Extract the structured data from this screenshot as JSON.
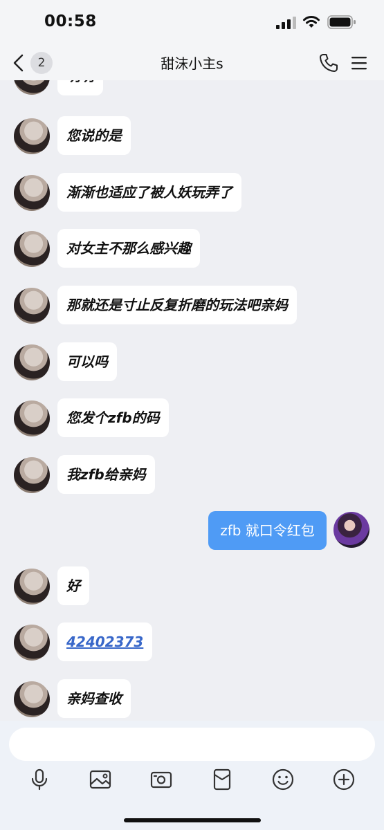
{
  "status_bar": {
    "time": "00:58"
  },
  "nav": {
    "unread_count": "2",
    "title": "甜沫小主s"
  },
  "messages": [
    {
      "side": "left",
      "text": "明明"
    },
    {
      "side": "left",
      "text": "您说的是"
    },
    {
      "side": "left",
      "text": "渐渐也适应了被人妖玩弄了"
    },
    {
      "side": "left",
      "text": "对女主不那么感兴趣"
    },
    {
      "side": "left",
      "text": "那就还是寸止反复折磨的玩法吧亲妈"
    },
    {
      "side": "left",
      "text": "可以吗"
    },
    {
      "side": "left",
      "text": "您发个zfb的码"
    },
    {
      "side": "left",
      "text": "我zfb给亲妈"
    },
    {
      "side": "right",
      "text": "zfb 就口令红包"
    },
    {
      "side": "left",
      "text": "好"
    },
    {
      "side": "left",
      "text": "42402373",
      "is_link": true
    },
    {
      "side": "left",
      "text": "亲妈查收"
    }
  ],
  "input": {
    "placeholder": ""
  },
  "toolbar": {
    "icons": [
      "microphone-icon",
      "photo-icon",
      "camera-icon",
      "red-packet-icon",
      "emoji-icon",
      "plus-icon"
    ]
  },
  "colors": {
    "background": "#eeeff3",
    "incoming_bubble": "#ffffff",
    "outgoing_bubble": "#4f9bf5",
    "link": "#3867c9"
  }
}
